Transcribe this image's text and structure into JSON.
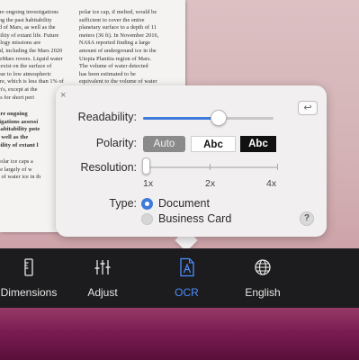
{
  "document": {
    "left_column": [
      "are ongoing investigations",
      "ing the past habitability",
      "ld of Mars, as well as the",
      "bility of extant life. Future",
      "ology missions are",
      "ed, including the Mars 2020",
      "soMars rovers. Liquid water",
      "t exist on the surface of",
      "due to low atmospheric",
      "are, which is less than 1% of",
      "th's, except at the",
      "ns for short peri",
      "",
      "are ongoing",
      "tigations assessi",
      "habitability pote",
      "s well as the",
      "bility of extant l",
      "",
      "polar ice caps a",
      "de largely of w",
      "e of water ice in th"
    ],
    "right_column": [
      "polar ice cap, if melted, would be",
      "sufficient to cover the entire",
      "planetary surface to a depth of 11",
      "meters (36 ft). In November 2016,",
      "NASA reported finding a large",
      "amount of underground ice in the",
      "Utopia Planitia region of Mars.",
      "The volume of water detected",
      "has been estimated to be",
      "equivalent to the volume of water"
    ]
  },
  "popover": {
    "close": "×",
    "revert": "↩",
    "readability_label": "Readability:",
    "readability_value": 0.58,
    "polarity_label": "Polarity:",
    "polarity_options": [
      "Auto",
      "Abc",
      "Abc"
    ],
    "polarity_selected": "Auto",
    "resolution_label": "Resolution:",
    "resolution_ticks": [
      "1x",
      "2x",
      "4x"
    ],
    "resolution_value": 0.0,
    "type_label": "Type:",
    "type_options": [
      "Document",
      "Business Card"
    ],
    "type_selected": "Document",
    "help": "?"
  },
  "toolbar": {
    "items": [
      {
        "label": "Dimensions",
        "icon": "ruler-icon"
      },
      {
        "label": "Adjust",
        "icon": "sliders-icon"
      },
      {
        "label": "OCR",
        "icon": "ocr-document-icon",
        "active": true
      },
      {
        "label": "English",
        "icon": "globe-icon"
      }
    ]
  },
  "colors": {
    "accent": "#3e7bdb",
    "active_tab": "#4c8dff",
    "toolbar_bg": "#1c1c1e"
  }
}
